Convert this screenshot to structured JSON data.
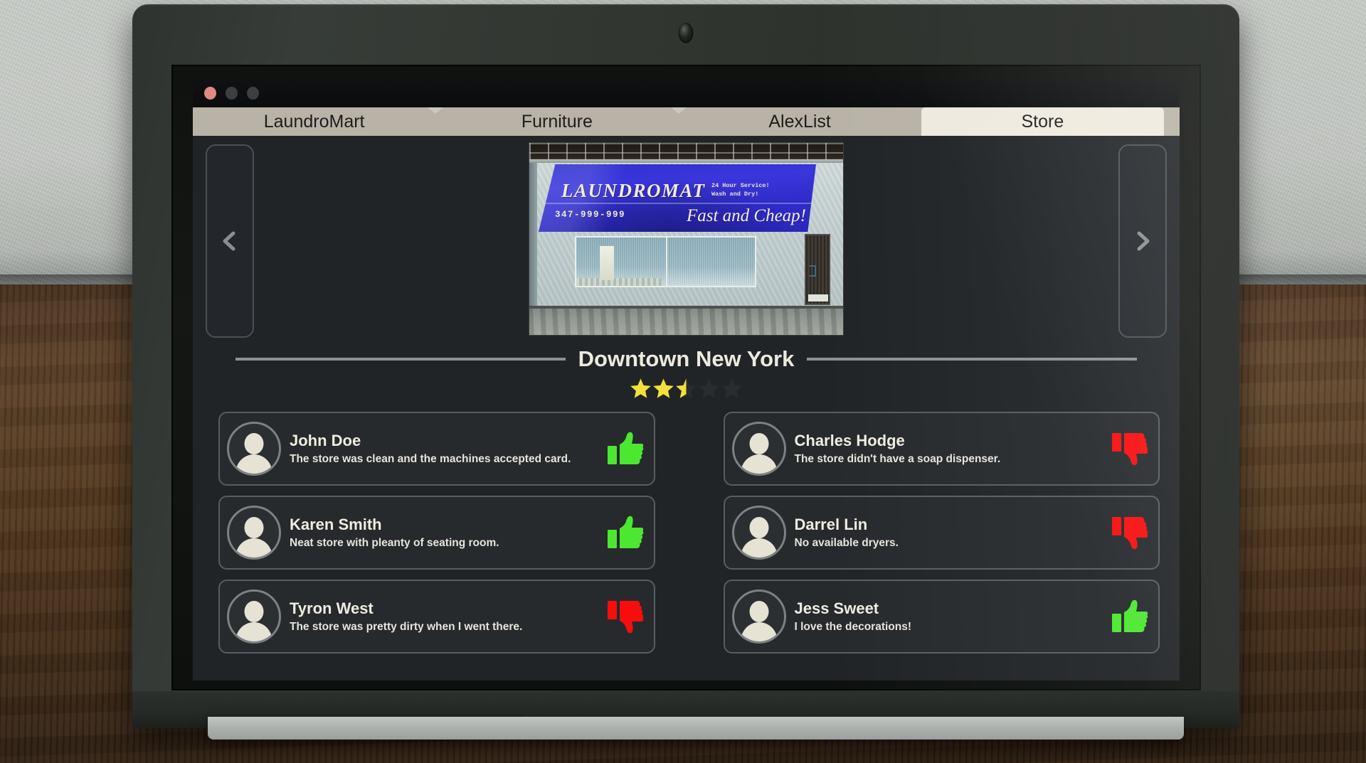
{
  "window": {
    "controls": [
      "close",
      "minimize",
      "maximize"
    ]
  },
  "tabs": [
    {
      "label": "LaundroMart",
      "active": false
    },
    {
      "label": "Furniture",
      "active": false
    },
    {
      "label": "AlexList",
      "active": false
    },
    {
      "label": "Store",
      "active": true
    }
  ],
  "carousel": {
    "prev_label": "‹",
    "next_label": "›",
    "storefront": {
      "brand": "LAUNDROMAT",
      "subtext": "24 Hour Service!\nWash and Dry!",
      "phone": "347-999-999",
      "slogan": "Fast and Cheap!",
      "awning_color": "#2f2fcf"
    }
  },
  "store": {
    "title": "Downtown New York",
    "rating": 2.5,
    "rating_max": 5,
    "star_filled_color": "#f2e03c",
    "star_empty_color": "#2a2d30"
  },
  "reviews": [
    {
      "name": "John Doe",
      "comment": "The store was clean and the machines accepted card.",
      "vote": "up",
      "vote_color": "#4ce831"
    },
    {
      "name": "Charles Hodge",
      "comment": "The store didn't have a soap dispenser.",
      "vote": "down",
      "vote_color": "#f80d0d"
    },
    {
      "name": "Karen Smith",
      "comment": "Neat store with pleanty of seating room.",
      "vote": "up",
      "vote_color": "#4ce831"
    },
    {
      "name": "Darrel Lin",
      "comment": "No available dryers.",
      "vote": "down",
      "vote_color": "#f80d0d"
    },
    {
      "name": "Tyron West",
      "comment": "The store was pretty dirty when I went there.",
      "vote": "down",
      "vote_color": "#f80d0d"
    },
    {
      "name": "Jess Sweet",
      "comment": "I love the decorations!",
      "vote": "up",
      "vote_color": "#4ce831"
    }
  ]
}
